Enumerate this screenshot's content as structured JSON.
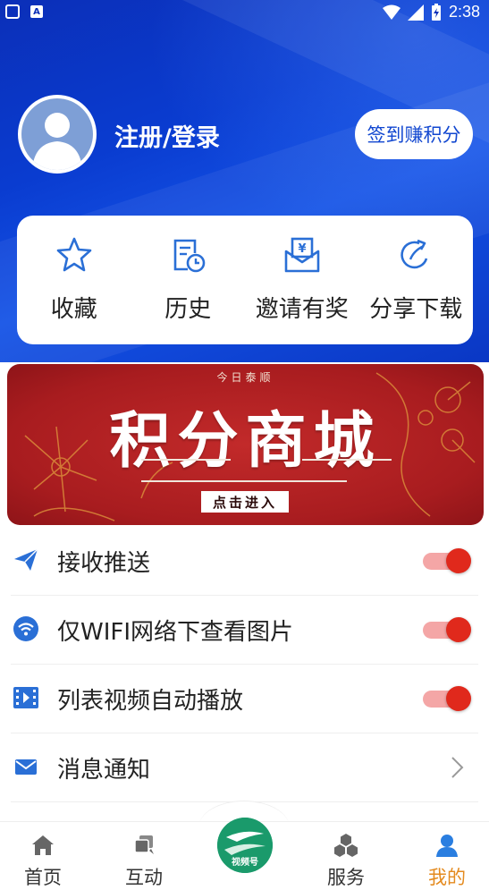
{
  "status_bar": {
    "time": "2:38"
  },
  "profile": {
    "login_text": "注册/登录",
    "signin_button": "签到赚积分"
  },
  "quick_actions": [
    {
      "label": "收藏",
      "icon": "star-icon"
    },
    {
      "label": "历史",
      "icon": "history-icon"
    },
    {
      "label": "邀请有奖",
      "icon": "invite-reward-icon"
    },
    {
      "label": "分享下载",
      "icon": "share-icon"
    }
  ],
  "banner": {
    "top_text": "今日泰顺",
    "title": "积分商城",
    "button": "点击进入"
  },
  "settings": [
    {
      "label": "接收推送",
      "icon": "send-icon",
      "type": "toggle",
      "on": true
    },
    {
      "label": "仅WIFI网络下查看图片",
      "icon": "wifi-icon",
      "type": "toggle",
      "on": true
    },
    {
      "label": "列表视频自动播放",
      "icon": "video-icon",
      "type": "toggle",
      "on": true
    },
    {
      "label": "消息通知",
      "icon": "mail-icon",
      "type": "link"
    }
  ],
  "bottom_nav": {
    "items": [
      {
        "label": "首页",
        "icon": "home-icon"
      },
      {
        "label": "互动",
        "icon": "interact-icon"
      },
      {
        "label": "服务",
        "icon": "services-icon"
      },
      {
        "label": "我的",
        "icon": "user-icon",
        "active": true
      }
    ],
    "center_label": "视频号"
  },
  "colors": {
    "header_blue": "#0a3cd0",
    "accent_red": "#e0291c",
    "active_orange": "#e48a1e",
    "banner_red": "#a81c1f"
  }
}
